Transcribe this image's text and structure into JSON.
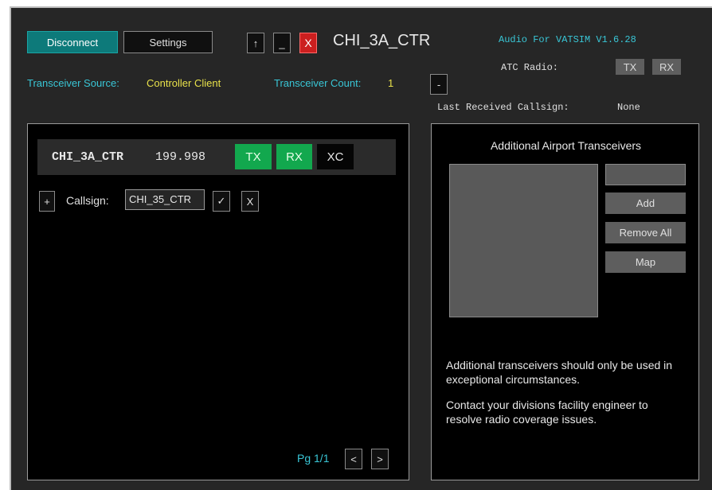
{
  "header": {
    "disconnect_label": "Disconnect",
    "settings_label": "Settings",
    "up_label": "↑",
    "minimize_label": "_",
    "close_label": "X",
    "callsign": "CHI_3A_CTR",
    "app_version": "Audio For VATSIM V1.6.28",
    "atc_radio_label": "ATC Radio:",
    "atc_tx": "TX",
    "atc_rx": "RX",
    "source_label": "Transceiver Source:",
    "source_value": "Controller Client",
    "count_label": "Transceiver Count:",
    "count_value": "1",
    "collapse_label": "-",
    "last_received_label": "Last Received Callsign:",
    "last_received_value": "None"
  },
  "station": {
    "name": "CHI_3A_CTR",
    "frequency": "199.998",
    "tx_label": "TX",
    "rx_label": "RX",
    "xc_label": "XC",
    "add_label": "+",
    "callsign_label": "Callsign:",
    "callsign_value": "CHI_35_CTR",
    "confirm_label": "✓",
    "cancel_label": "X",
    "pager_label": "Pg 1/1",
    "prev_label": "<",
    "next_label": ">"
  },
  "airport": {
    "title": "Additional Airport Transceivers",
    "input_value": "",
    "add_label": "Add",
    "remove_all_label": "Remove All",
    "map_label": "Map",
    "note1": "Additional transceivers should only be used in exceptional circumstances.",
    "note2": "Contact your divisions facility engineer to resolve radio coverage issues."
  },
  "colors": {
    "teal_text": "#39c6d6",
    "yellow_text": "#e8e14a",
    "green_button": "#12a84e",
    "red_button": "#cc1f1f"
  }
}
